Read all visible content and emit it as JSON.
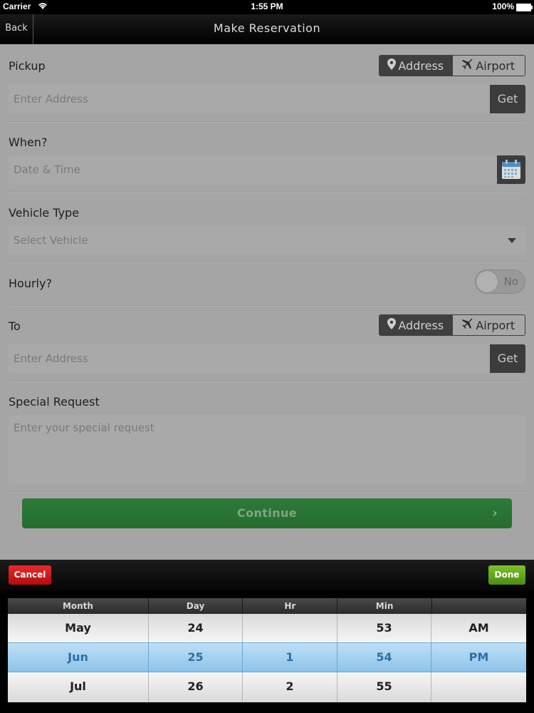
{
  "status_bar": {
    "carrier": "Carrier",
    "time": "1:55 PM",
    "battery": "100%"
  },
  "nav": {
    "back_label": "Back",
    "title": "Make Reservation"
  },
  "pickup": {
    "label": "Pickup",
    "toggle": {
      "address": "Address",
      "airport": "Airport",
      "selected": "Address"
    },
    "placeholder": "Enter Address",
    "get_label": "Get"
  },
  "when": {
    "label": "When?",
    "placeholder": "Date & Time"
  },
  "vehicle": {
    "label": "Vehicle Type",
    "placeholder": "Select Vehicle"
  },
  "hourly": {
    "label": "Hourly?",
    "value": "No"
  },
  "to": {
    "label": "To",
    "toggle": {
      "address": "Address",
      "airport": "Airport",
      "selected": "Address"
    },
    "placeholder": "Enter Address",
    "get_label": "Get"
  },
  "special": {
    "label": "Special Request",
    "placeholder": "Enter your special request"
  },
  "continue_label": "Continue",
  "picker": {
    "cancel_label": "Cancel",
    "done_label": "Done",
    "columns": [
      "Month",
      "Day",
      "Hr",
      "Min",
      ""
    ],
    "rows": [
      [
        "May",
        "24",
        "",
        "53",
        "AM"
      ],
      [
        "Jun",
        "25",
        "1",
        "54",
        "PM"
      ],
      [
        "Jul",
        "26",
        "2",
        "55",
        ""
      ]
    ],
    "selected_row": 1
  },
  "colors": {
    "continue": "#2a7434",
    "cancel": "#d01c1c",
    "done": "#66a81e",
    "picker_selected": "#a6d2f0"
  }
}
